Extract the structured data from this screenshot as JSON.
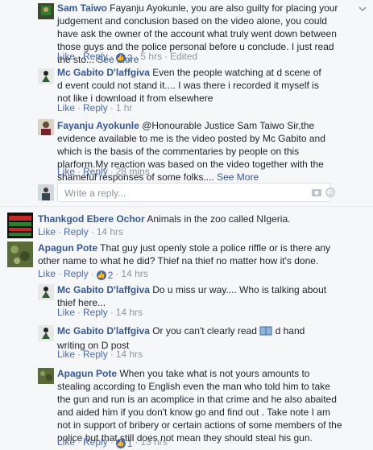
{
  "comments": [
    {
      "name": "Sam Taiwo",
      "text": "Fayanju Ayokunle, you are also guilty for placing your judgement and conclusion based on the video alone, you could have ask the owner of the account what truly went down between those guys and the police personal before u conclude. I just read the sto...",
      "more": "See More",
      "like": "Like",
      "reply": "Reply",
      "reaction_count": "2",
      "time": "5 hrs",
      "edited": "Edited"
    },
    {
      "name": "Mc Gabito D'laffgiva",
      "text": "Even the people watching at d scene of d event could not stand it.... I was there i recorded it myself is not like i download it from elsewhere",
      "like": "Like",
      "reply": "Reply",
      "time": "1 hr"
    },
    {
      "name": "Fayanju Ayokunle",
      "text": "@Honourable Justice Sam Taiwo Sir,the evidence available to me is the video posted by Mc Gabito and which is the basis of the commentaries by people on this plarform.My reaction was based on the video together with the shameful responses of some folks....",
      "more": "See More",
      "like": "Like",
      "reply": "Reply",
      "time": "28 mins"
    },
    {
      "name": "Thankgod Ebere Ochor",
      "text": "Animals in the zoo called NIgeria.",
      "like": "Like",
      "reply": "Reply",
      "time": "14 hrs"
    },
    {
      "name": "Apagun Pote",
      "text": "That guy just openly stole a police riffle or is there any other name to what he did? Thief na thief no matter how it's done.",
      "like": "Like",
      "reply": "Reply",
      "reaction_count": "2",
      "time": "14 hrs"
    },
    {
      "name": "Mc Gabito D'laffgiva",
      "text": "Do u miss ur way.... Who is talking about thief here...",
      "like": "Like",
      "reply": "Reply",
      "time": "14 hrs"
    },
    {
      "name": "Mc Gabito D'laffgiva",
      "text_before": "Or you can't clearly read",
      "text_after": "d hand writing on D post",
      "like": "Like",
      "reply": "Reply",
      "time": "14 hrs"
    },
    {
      "name": "Apagun Pote",
      "text": "When you take what is not yours amounts to stealing according to English even the man who told him to take the gun and run is an acomplice in that crime and he also abaited and aided him if you don't know go and find out . Take note I am not in support of bribery or certain actions of some members of the police but that still does not mean they should steal his gun.",
      "like": "Like",
      "reply": "Reply",
      "reaction_count": "1",
      "time": "13 hrs"
    }
  ],
  "reply_box": {
    "placeholder": "Write a reply..."
  },
  "colors": {
    "link": "#365899",
    "meta": "#90949c",
    "like_badge": "#4267b2",
    "background": "#f6f7f9"
  },
  "icons": [
    "chevron-down-icon",
    "like-reaction-icon",
    "camera-icon",
    "sticker-icon"
  ]
}
